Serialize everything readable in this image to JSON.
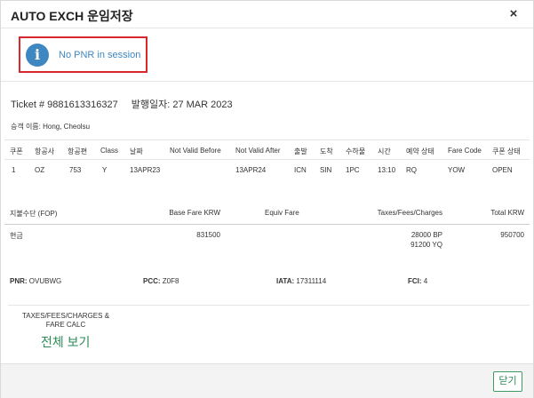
{
  "header": {
    "title": "AUTO EXCH 운임저장",
    "close_glyph": "×"
  },
  "notice": {
    "icon": "info-icon",
    "icon_glyph": "i",
    "message": "No PNR in session"
  },
  "ticket": {
    "ticket_no": "Ticket # 9881613316327",
    "issue_date": "발행일자: 27 MAR 2023",
    "passenger_label": "승객 이름: ",
    "passenger_name": "Hong, Cheolsu"
  },
  "segments": {
    "headers": [
      "쿠폰",
      "항공사",
      "항공편",
      "Class",
      "날짜",
      "Not Valid Before",
      "Not Valid After",
      "출발",
      "도착",
      "수하물",
      "시간",
      "예약 상태",
      "Fare Code",
      "쿠폰 상태"
    ],
    "rows": [
      [
        "1",
        "OZ",
        "753",
        "Y",
        "13APR23",
        "",
        "13APR24",
        "ICN",
        "SIN",
        "1PC",
        "13:10",
        "RQ",
        "YOW",
        "OPEN"
      ]
    ]
  },
  "fare": {
    "headers": {
      "fop": "지불수단 (FOP)",
      "base_fare": "Base Fare KRW",
      "equiv_fare": "Equiv Fare",
      "taxes": "Taxes/Fees/Charges",
      "total": "Total KRW"
    },
    "row": {
      "fop": "현금",
      "base_fare": "831500",
      "equiv_fare": "",
      "tax1": "28000 BP",
      "tax2": "91200 YQ",
      "total": "950700"
    }
  },
  "info": {
    "pnr_label": "PNR:",
    "pnr": " OVUBWG",
    "pcc_label": "PCC:",
    "pcc": " Z0F8",
    "iata_label": "IATA:",
    "iata": " 17311114",
    "fci_label": "FCI:",
    "fci": " 4"
  },
  "calc": {
    "label": "TAXES/FEES/CHARGES & FARE CALC",
    "link": "전체 보기"
  },
  "footer": {
    "close_label": "닫기"
  },
  "colors": {
    "accent": "#3f87c0",
    "highlight_border": "#d9272e",
    "link_green": "#2e8b57"
  }
}
